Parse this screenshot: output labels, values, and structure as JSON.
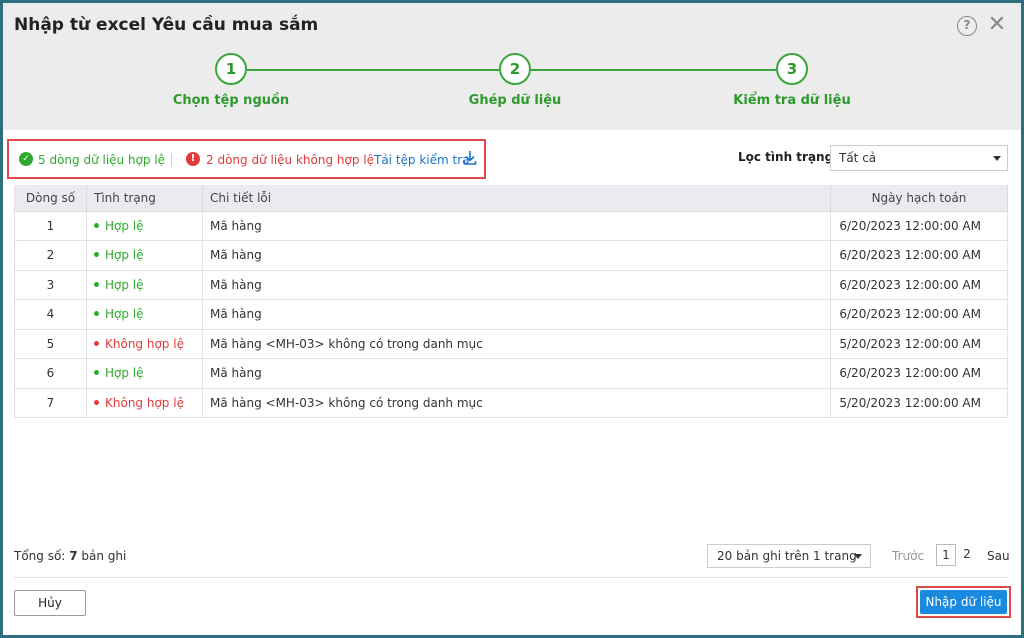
{
  "dialog": {
    "title": "Nhập từ excel Yêu cầu mua sắm",
    "help_icon": "?",
    "close_icon": "✕"
  },
  "steps": [
    {
      "number": "1",
      "label": "Chọn tệp nguồn"
    },
    {
      "number": "2",
      "label": "Ghép dữ liệu"
    },
    {
      "number": "3",
      "label": "Kiểm tra dữ liệu"
    }
  ],
  "summary": {
    "valid_text": "5 dòng dữ liệu hợp lệ",
    "invalid_text": "2 dòng dữ liệu không hợp lệ",
    "download_label": "Tải tệp kiểm tra"
  },
  "filter": {
    "label": "Lọc tình trạng",
    "selected": "Tất cả"
  },
  "table": {
    "columns": [
      "Dòng số",
      "Tình trạng",
      "Chi tiết lỗi",
      "Ngày hạch toán"
    ],
    "rows": [
      {
        "num": "1",
        "status": "Hợp lệ",
        "valid": true,
        "detail": "Mã hàng",
        "date": "6/20/2023 12:00:00 AM"
      },
      {
        "num": "2",
        "status": "Hợp lệ",
        "valid": true,
        "detail": "Mã hàng",
        "date": "6/20/2023 12:00:00 AM"
      },
      {
        "num": "3",
        "status": "Hợp lệ",
        "valid": true,
        "detail": "Mã hàng",
        "date": "6/20/2023 12:00:00 AM"
      },
      {
        "num": "4",
        "status": "Hợp lệ",
        "valid": true,
        "detail": "Mã hàng",
        "date": "6/20/2023 12:00:00 AM"
      },
      {
        "num": "5",
        "status": "Không hợp lệ",
        "valid": false,
        "detail": "Mã hàng <MH-03> không có trong danh mục",
        "date": "5/20/2023 12:00:00 AM"
      },
      {
        "num": "6",
        "status": "Hợp lệ",
        "valid": true,
        "detail": "Mã hàng",
        "date": "6/20/2023 12:00:00 AM"
      },
      {
        "num": "7",
        "status": "Không hợp lệ",
        "valid": false,
        "detail": "Mã hàng <MH-03> không có trong danh mục",
        "date": "5/20/2023 12:00:00 AM"
      }
    ]
  },
  "pagination": {
    "total_label": "Tổng số:",
    "total_count": "7",
    "total_unit": "bản ghi",
    "page_size": "20 bản ghi trên 1 trang",
    "prev": "Trước",
    "pages": [
      "1",
      "2"
    ],
    "next": "Sau"
  },
  "footer": {
    "cancel_label": "Hủy",
    "import_label": "Nhập dữ liệu"
  },
  "colors": {
    "accent_green": "#2eaa2e",
    "error_red": "#e03c3c",
    "primary_blue": "#1a8ae0",
    "link_blue": "#1a73c8"
  }
}
